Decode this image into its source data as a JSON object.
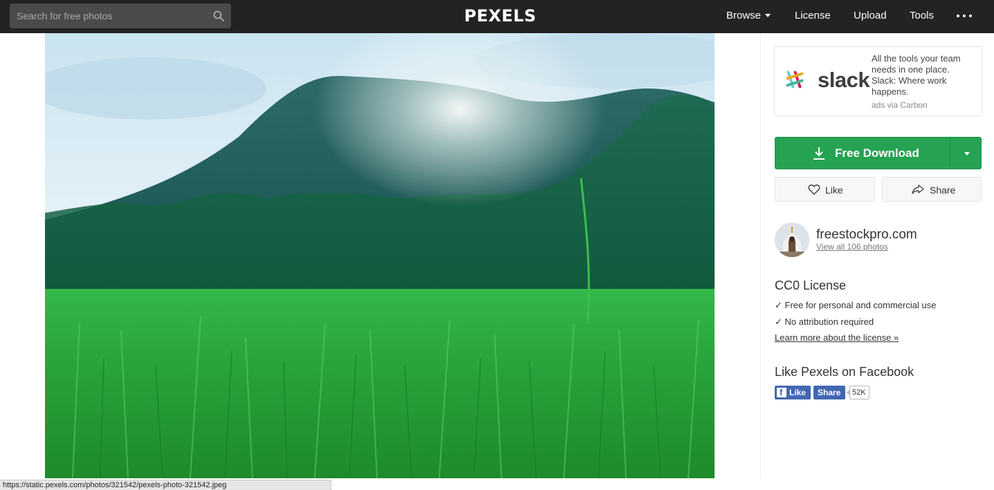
{
  "header": {
    "search": {
      "placeholder": "Search for free photos",
      "value": ""
    },
    "logo": "PEXELS",
    "nav": {
      "browse": "Browse",
      "license": "License",
      "upload": "Upload",
      "tools": "Tools"
    },
    "icons": {
      "search": "search-icon",
      "browse_caret": "chevron-down-icon",
      "more": "more-dots-icon"
    }
  },
  "photo": {
    "subject": "green rice field with forested hill under bright sky"
  },
  "ad": {
    "brand": "slack",
    "text": "All the tools your team needs in one place. Slack: Where work happens.",
    "via": "ads via Carbon"
  },
  "download": {
    "label": "Free Download",
    "color": "#25a352",
    "icon": "download-icon"
  },
  "actions": {
    "like": "Like",
    "share": "Share"
  },
  "author": {
    "name": "freestockpro.com",
    "link": "View all 106 photos"
  },
  "license": {
    "title": "CC0 License",
    "items": [
      "✓ Free for personal and commercial use",
      "✓ No attribution required"
    ],
    "learn_more": "Learn more about the license »"
  },
  "facebook": {
    "title": "Like Pexels on Facebook",
    "like": "Like",
    "share": "Share",
    "count": "52K",
    "color": "#4267b2"
  },
  "status_url": "https://static.pexels.com/photos/321542/pexels-photo-321542.jpeg"
}
